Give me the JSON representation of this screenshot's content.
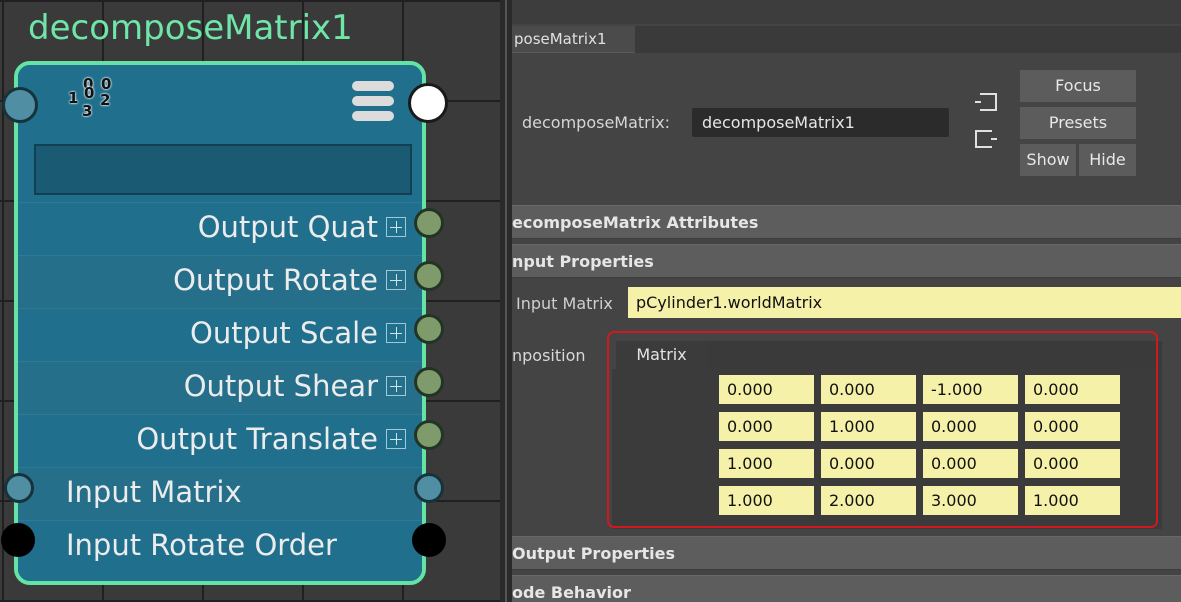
{
  "node": {
    "title": "decomposeMatrix1",
    "icon_name": "matrix-icon",
    "icon_digits": [
      "0",
      "0",
      "1",
      "0",
      "2",
      "3"
    ],
    "attributes": [
      {
        "label": "Output Quat",
        "direction": "output",
        "expandable": true
      },
      {
        "label": "Output Rotate",
        "direction": "output",
        "expandable": true
      },
      {
        "label": "Output Scale",
        "direction": "output",
        "expandable": true
      },
      {
        "label": "Output Shear",
        "direction": "output",
        "expandable": true
      },
      {
        "label": "Output Translate",
        "direction": "output",
        "expandable": true
      },
      {
        "label": "Input Matrix",
        "direction": "input",
        "expandable": false
      },
      {
        "label": "Input Rotate Order",
        "direction": "input",
        "expandable": false
      }
    ],
    "colors": {
      "border": "#64e3a4",
      "body": "#1f6f8d",
      "title": "#6fe5a8"
    }
  },
  "attribute_editor": {
    "tab_label": "poseMatrix1",
    "node_type_label": "decomposeMatrix:",
    "node_name_value": "decomposeMatrix1",
    "buttons": {
      "focus": "Focus",
      "presets": "Presets",
      "show": "Show",
      "hide": "Hide"
    },
    "sections": {
      "attributes": "ecomposeMatrix Attributes",
      "input_properties": "nput Properties",
      "output_properties": "Output Properties",
      "node_behavior": "ode Behavior"
    },
    "input_matrix": {
      "label": "Input Matrix",
      "value": "pCylinder1.worldMatrix"
    },
    "tabs": {
      "inactive": "nposition",
      "active": "Matrix"
    },
    "matrix": [
      [
        "0.000",
        "0.000",
        "-1.000",
        "0.000"
      ],
      [
        "0.000",
        "1.000",
        "0.000",
        "0.000"
      ],
      [
        "1.000",
        "0.000",
        "0.000",
        "0.000"
      ],
      [
        "1.000",
        "2.000",
        "3.000",
        "1.000"
      ]
    ],
    "highlight_color": "#d0191f"
  }
}
